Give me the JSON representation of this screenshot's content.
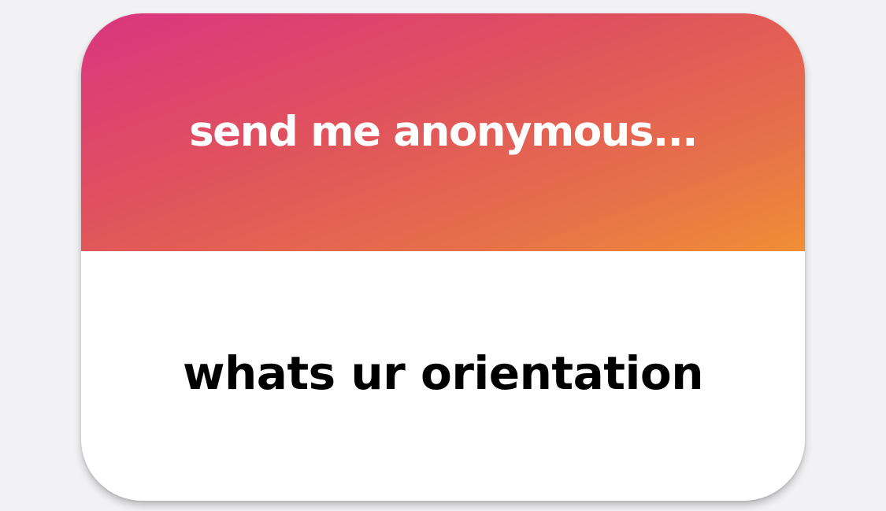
{
  "question_card": {
    "prompt": "send me anonymous...",
    "response": "whats ur orientation"
  },
  "colors": {
    "gradient_start": "#da3580",
    "gradient_end": "#f08f35",
    "background": "#f2f2f4"
  }
}
